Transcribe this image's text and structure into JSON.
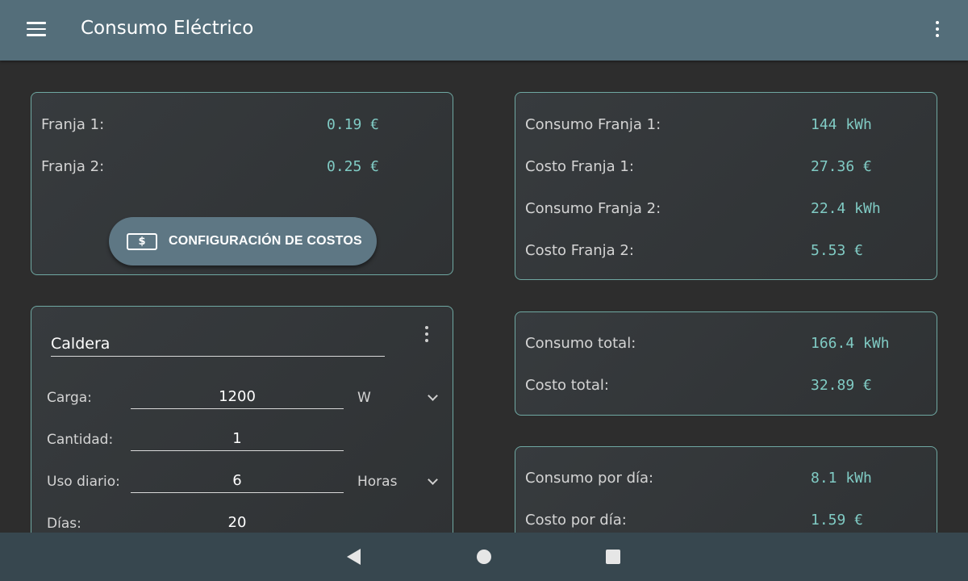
{
  "appbar": {
    "title": "Consumo Eléctrico",
    "menu_icon": "hamburger-menu-icon",
    "overflow_icon": "more-vert-icon"
  },
  "costs_card": {
    "rows": [
      {
        "label": "Franja 1:",
        "value": "0.19 €"
      },
      {
        "label": "Franja 2:",
        "value": "0.25 €"
      }
    ],
    "config_button": {
      "label": "CONFIGURACIÓN DE COSTOS",
      "icon": "money-icon",
      "icon_glyph": "$"
    }
  },
  "device_card": {
    "name": "Caldera",
    "overflow_icon": "more-vert-icon",
    "fields": {
      "carga": {
        "label": "Carga:",
        "value": "1200",
        "unit": "W"
      },
      "cantidad": {
        "label": "Cantidad:",
        "value": "1"
      },
      "uso_diario": {
        "label": "Uso diario:",
        "value": "6",
        "unit": "Horas"
      },
      "dias": {
        "label": "Días:",
        "value": "20"
      }
    }
  },
  "franjas_summary": {
    "rows": [
      {
        "label": "Consumo Franja 1:",
        "value": "144 kWh"
      },
      {
        "label": "Costo Franja 1:",
        "value": "27.36 €"
      },
      {
        "label": "Consumo Franja 2:",
        "value": "22.4 kWh"
      },
      {
        "label": "Costo Franja 2:",
        "value": "5.53 €"
      }
    ]
  },
  "total_summary": {
    "rows": [
      {
        "label": "Consumo total:",
        "value": "166.4 kWh"
      },
      {
        "label": "Costo total:",
        "value": "32.89 €"
      }
    ]
  },
  "daily_summary": {
    "rows": [
      {
        "label": "Consumo por día:",
        "value": "8.1 kWh"
      },
      {
        "label": "Costo por día:",
        "value": "1.59 €"
      }
    ]
  },
  "colors": {
    "appbar": "#546e7a",
    "background": "#2d2d2d",
    "card_border": "#6fa8a2",
    "accent_value": "#80cbc4",
    "navbar": "#37474f"
  }
}
